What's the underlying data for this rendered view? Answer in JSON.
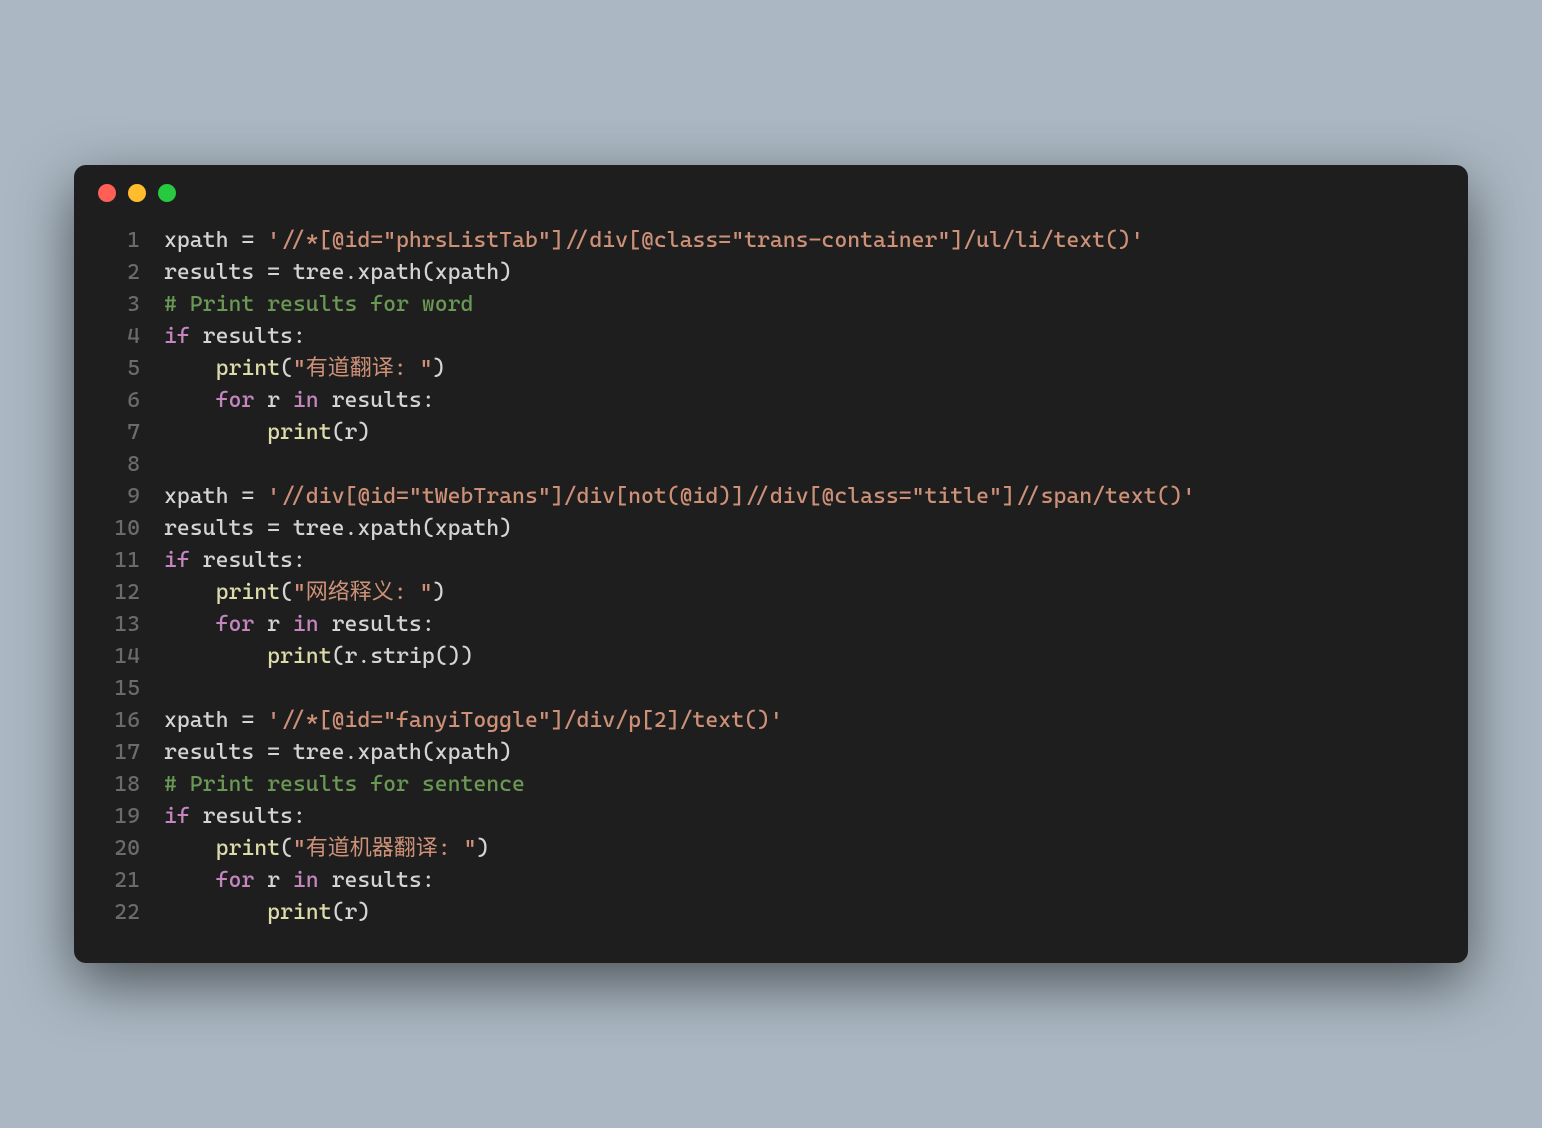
{
  "window": {
    "dots": [
      "red",
      "yellow",
      "green"
    ]
  },
  "code": {
    "lines": [
      {
        "n": 1,
        "tokens": [
          {
            "c": "tok-default",
            "t": "xpath = "
          },
          {
            "c": "tok-str",
            "t": "'//*[@id=\"phrsListTab\"]//div[@class=\"trans-container\"]/ul/li/text()'"
          }
        ]
      },
      {
        "n": 2,
        "tokens": [
          {
            "c": "tok-default",
            "t": "results = tree.xpath(xpath)"
          }
        ]
      },
      {
        "n": 3,
        "tokens": [
          {
            "c": "tok-comment",
            "t": "# Print results for word"
          }
        ]
      },
      {
        "n": 4,
        "tokens": [
          {
            "c": "tok-kw",
            "t": "if"
          },
          {
            "c": "tok-default",
            "t": " results:"
          }
        ]
      },
      {
        "n": 5,
        "tokens": [
          {
            "c": "tok-default",
            "t": "    "
          },
          {
            "c": "tok-builtin",
            "t": "print"
          },
          {
            "c": "tok-default",
            "t": "("
          },
          {
            "c": "tok-str",
            "t": "\"有道翻译: \""
          },
          {
            "c": "tok-default",
            "t": ")"
          }
        ]
      },
      {
        "n": 6,
        "tokens": [
          {
            "c": "tok-default",
            "t": "    "
          },
          {
            "c": "tok-kw",
            "t": "for"
          },
          {
            "c": "tok-default",
            "t": " r "
          },
          {
            "c": "tok-kw",
            "t": "in"
          },
          {
            "c": "tok-default",
            "t": " results:"
          }
        ]
      },
      {
        "n": 7,
        "tokens": [
          {
            "c": "tok-default",
            "t": "        "
          },
          {
            "c": "tok-builtin",
            "t": "print"
          },
          {
            "c": "tok-default",
            "t": "(r)"
          }
        ]
      },
      {
        "n": 8,
        "tokens": [
          {
            "c": "tok-default",
            "t": ""
          }
        ]
      },
      {
        "n": 9,
        "tokens": [
          {
            "c": "tok-default",
            "t": "xpath = "
          },
          {
            "c": "tok-str",
            "t": "'//div[@id=\"tWebTrans\"]/div[not(@id)]//div[@class=\"title\"]//span/text()'"
          }
        ]
      },
      {
        "n": 10,
        "tokens": [
          {
            "c": "tok-default",
            "t": "results = tree.xpath(xpath)"
          }
        ]
      },
      {
        "n": 11,
        "tokens": [
          {
            "c": "tok-kw",
            "t": "if"
          },
          {
            "c": "tok-default",
            "t": " results:"
          }
        ]
      },
      {
        "n": 12,
        "tokens": [
          {
            "c": "tok-default",
            "t": "    "
          },
          {
            "c": "tok-builtin",
            "t": "print"
          },
          {
            "c": "tok-default",
            "t": "("
          },
          {
            "c": "tok-str",
            "t": "\"网络释义: \""
          },
          {
            "c": "tok-default",
            "t": ")"
          }
        ]
      },
      {
        "n": 13,
        "tokens": [
          {
            "c": "tok-default",
            "t": "    "
          },
          {
            "c": "tok-kw",
            "t": "for"
          },
          {
            "c": "tok-default",
            "t": " r "
          },
          {
            "c": "tok-kw",
            "t": "in"
          },
          {
            "c": "tok-default",
            "t": " results:"
          }
        ]
      },
      {
        "n": 14,
        "tokens": [
          {
            "c": "tok-default",
            "t": "        "
          },
          {
            "c": "tok-builtin",
            "t": "print"
          },
          {
            "c": "tok-default",
            "t": "(r.strip())"
          }
        ]
      },
      {
        "n": 15,
        "tokens": [
          {
            "c": "tok-default",
            "t": ""
          }
        ]
      },
      {
        "n": 16,
        "tokens": [
          {
            "c": "tok-default",
            "t": "xpath = "
          },
          {
            "c": "tok-str",
            "t": "'//*[@id=\"fanyiToggle\"]/div/p[2]/text()'"
          }
        ]
      },
      {
        "n": 17,
        "tokens": [
          {
            "c": "tok-default",
            "t": "results = tree.xpath(xpath)"
          }
        ]
      },
      {
        "n": 18,
        "tokens": [
          {
            "c": "tok-comment",
            "t": "# Print results for sentence"
          }
        ]
      },
      {
        "n": 19,
        "tokens": [
          {
            "c": "tok-kw",
            "t": "if"
          },
          {
            "c": "tok-default",
            "t": " results:"
          }
        ]
      },
      {
        "n": 20,
        "tokens": [
          {
            "c": "tok-default",
            "t": "    "
          },
          {
            "c": "tok-builtin",
            "t": "print"
          },
          {
            "c": "tok-default",
            "t": "("
          },
          {
            "c": "tok-str",
            "t": "\"有道机器翻译: \""
          },
          {
            "c": "tok-default",
            "t": ")"
          }
        ]
      },
      {
        "n": 21,
        "tokens": [
          {
            "c": "tok-default",
            "t": "    "
          },
          {
            "c": "tok-kw",
            "t": "for"
          },
          {
            "c": "tok-default",
            "t": " r "
          },
          {
            "c": "tok-kw",
            "t": "in"
          },
          {
            "c": "tok-default",
            "t": " results:"
          }
        ]
      },
      {
        "n": 22,
        "tokens": [
          {
            "c": "tok-default",
            "t": "        "
          },
          {
            "c": "tok-builtin",
            "t": "print"
          },
          {
            "c": "tok-default",
            "t": "(r)"
          }
        ]
      }
    ]
  }
}
